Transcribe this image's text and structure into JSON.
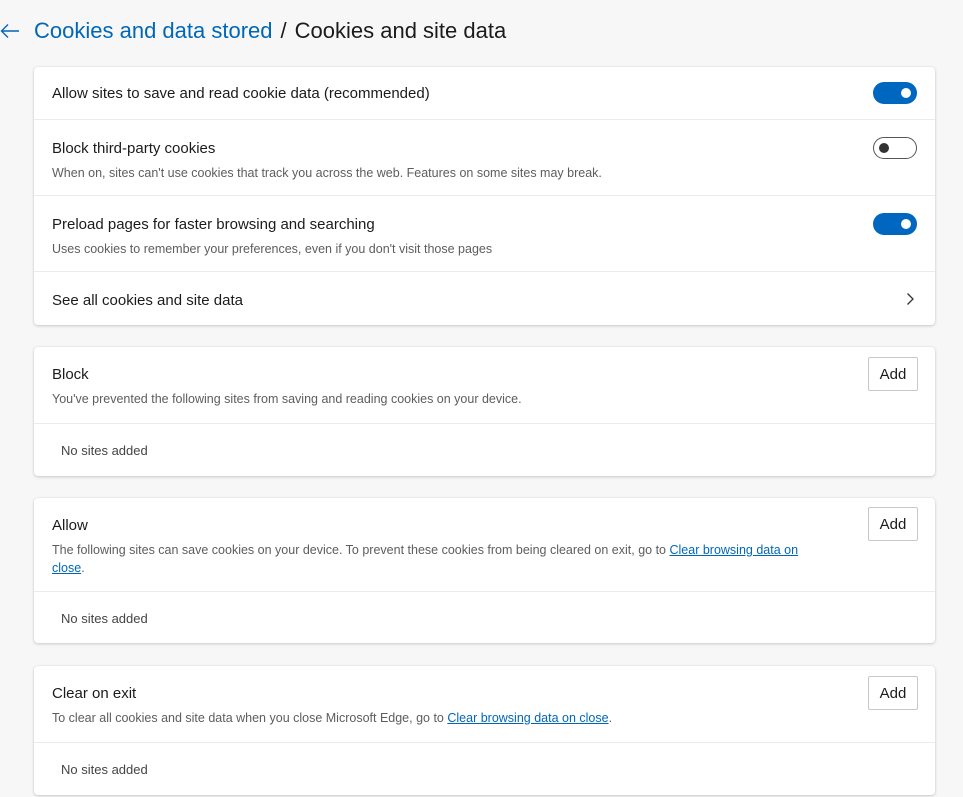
{
  "header": {
    "parent_link": "Cookies and data stored",
    "separator": "/",
    "current": "Cookies and site data"
  },
  "settings": {
    "allow_save_read": {
      "label": "Allow sites to save and read cookie data (recommended)",
      "state": "on"
    },
    "block_third_party": {
      "label": "Block third-party cookies",
      "description": "When on, sites can't use cookies that track you across the web. Features on some sites may break.",
      "state": "off"
    },
    "preload": {
      "label": "Preload pages for faster browsing and searching",
      "description": "Uses cookies to remember your preferences, even if you don't visit those pages",
      "state": "on"
    },
    "see_all": {
      "label": "See all cookies and site data"
    }
  },
  "block": {
    "title": "Block",
    "description": "You've prevented the following sites from saving and reading cookies on your device.",
    "add_label": "Add",
    "empty": "No sites added"
  },
  "allow": {
    "title": "Allow",
    "description_prefix": "The following sites can save cookies on your device. To prevent these cookies from being cleared on exit, go to ",
    "link_line1": "Clear browsing data on",
    "link_line2": "close",
    "description_suffix": ".",
    "add_label": "Add",
    "empty": "No sites added"
  },
  "clear_on_exit": {
    "title": "Clear on exit",
    "description_prefix": "To clear all cookies and site data when you close Microsoft Edge, go to ",
    "link": "Clear browsing data on close",
    "description_suffix": ".",
    "add_label": "Add",
    "empty": "No sites added"
  },
  "colors": {
    "accent": "#0067c0",
    "link": "#0067b8",
    "background": "#f7f7f7"
  }
}
